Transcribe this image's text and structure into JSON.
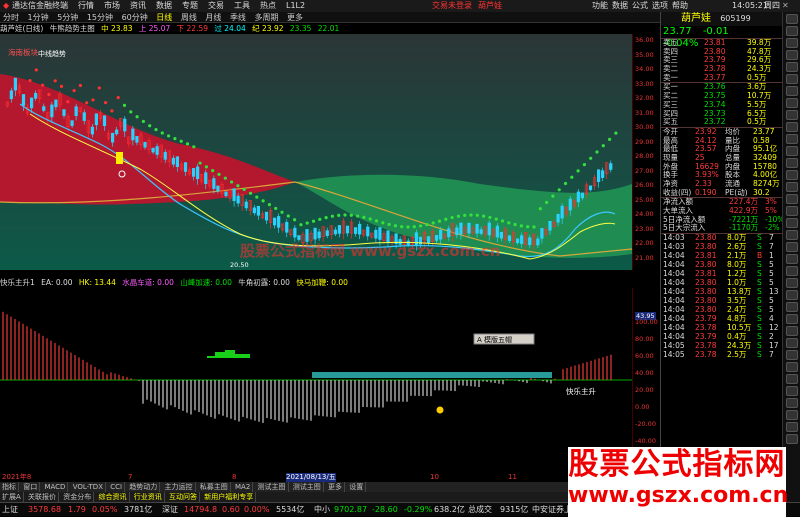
{
  "menubar": {
    "brand": "通达信金融终端",
    "items": [
      "行情",
      "市场",
      "资讯",
      "数据",
      "专题",
      "交易",
      "工具",
      "热点",
      "L1L2"
    ],
    "login": "交易未登录",
    "stock": "葫芦娃",
    "right": [
      "功能",
      "数据",
      "公式",
      "选项",
      "帮助"
    ],
    "time": "14:05:21",
    "weekday": "周四"
  },
  "periods": [
    "分时",
    "1分钟",
    "5分钟",
    "15分钟",
    "60分钟",
    "日线",
    "周线",
    "月线",
    "季线",
    "多周期",
    "更多"
  ],
  "active_period": "日线",
  "main_info": {
    "title": "葫芦娃(日线)",
    "formula": "牛熊趋势主图",
    "v1": "中 23.83",
    "v2": "上 25.07",
    "v3": "下 22.59",
    "v4": "过 24.04",
    "v5": "纪 23.92",
    "v6": "23.35",
    "v7": "22.01"
  },
  "chart_labels": {
    "top_left": "海南板块",
    "pattern": "中线趋势",
    "low_label": "20.50"
  },
  "price_axis": [
    "36.00",
    "35.00",
    "34.00",
    "33.00",
    "32.00",
    "31.00",
    "30.00",
    "29.00",
    "28.00",
    "27.00",
    "26.00",
    "25.00",
    "24.00",
    "23.00",
    "22.00",
    "21.00"
  ],
  "ind_info": {
    "name": "快乐主升1",
    "ea": "EA: 0.00",
    "hk": "HK: 13.44",
    "sub1": "水晶车道: 0.00",
    "sub2": "山峰加速: 0.00",
    "sub3": "牛角初露: 0.00",
    "sub4": "快马加鞭: 0.00"
  },
  "sub_axis": [
    "100.00",
    "80.00",
    "60.00",
    "40.00",
    "20.00",
    "0.00",
    "-20.00",
    "-40.00",
    "-60.00",
    "-80.00"
  ],
  "sub_marker": "43.95",
  "sub_label": "快乐主升",
  "popup": "A 模版五帽",
  "time_axis": [
    "2021年8",
    "7",
    "8",
    "9",
    "2021/08/13/五",
    "10",
    "11"
  ],
  "tabs1": [
    "指标",
    "窗口",
    "MACD",
    "VOL-TDX",
    "CCI",
    "趋势动力",
    "主力运控",
    "私募主图",
    "MA2",
    "测试主图",
    "测试主图",
    "更多",
    "设置"
  ],
  "tabs2": [
    "扩展A",
    "关联报价",
    "资金分布",
    "综合资讯",
    "行业资讯",
    "互动问答",
    "新用户福利专享"
  ],
  "status": {
    "sh_label": "上证",
    "sh_val": "3578.68",
    "sh_chg": "1.79",
    "sh_pct": "0.05%",
    "sh_amt": "3781亿",
    "sz_label": "深证",
    "sz_val": "14794.8",
    "sz_chg": "0.60",
    "sz_pct": "0.00%",
    "sz_amt": "5534亿",
    "zx_label": "中小",
    "zx_val": "9702.87",
    "zx_chg": "-28.60",
    "zx_pct": "-0.29%",
    "zx_amt": "638.2亿",
    "total_label": "总成交",
    "total_amt": "9315亿",
    "broker": "中安证券上海上证 深分"
  },
  "stock": {
    "name": "葫芦娃",
    "code": "605199",
    "price": "23.77",
    "change": "-0.01",
    "pct": "-0.04%"
  },
  "asks": [
    {
      "l": "卖五",
      "p": "23.81",
      "v": "39.8万"
    },
    {
      "l": "卖四",
      "p": "23.80",
      "v": "47.8万"
    },
    {
      "l": "卖三",
      "p": "23.79",
      "v": "29.6万"
    },
    {
      "l": "卖二",
      "p": "23.78",
      "v": "24.3万"
    },
    {
      "l": "卖一",
      "p": "23.77",
      "v": "0.5万"
    }
  ],
  "bids": [
    {
      "l": "买一",
      "p": "23.76",
      "v": "3.6万"
    },
    {
      "l": "买二",
      "p": "23.75",
      "v": "10.7万"
    },
    {
      "l": "买三",
      "p": "23.74",
      "v": "5.5万"
    },
    {
      "l": "买四",
      "p": "23.73",
      "v": "6.5万"
    },
    {
      "l": "买五",
      "p": "23.72",
      "v": "0.5万"
    }
  ],
  "stats": [
    [
      "今开",
      "23.92",
      "均价",
      "23.77"
    ],
    [
      "最高",
      "24.12",
      "量比",
      "0.58"
    ],
    [
      "最低",
      "23.57",
      "内盘",
      "95.1亿"
    ],
    [
      "现量",
      "25",
      "总量",
      "32409"
    ],
    [
      "外盘",
      "16629",
      "内盘",
      "15780"
    ],
    [
      "换手",
      "3.93%",
      "股本",
      "4.00亿"
    ],
    [
      "净资",
      "2.33",
      "流通",
      "8274万"
    ],
    [
      "收益(四)",
      "0.190",
      "PE(动)",
      "30.2"
    ]
  ],
  "flows": [
    [
      "净流入额",
      "227.4万",
      "3%"
    ],
    [
      "大单流入",
      "422.9万",
      "5%"
    ],
    [
      "5日净流入额",
      "-7221万",
      "-10%"
    ],
    [
      "5日大宗流入",
      "-1170万",
      "-2%"
    ]
  ],
  "ticks": [
    [
      "14:03",
      "23.80",
      "8.0万",
      "S",
      "7"
    ],
    [
      "14:03",
      "23.80",
      "2.6万",
      "S",
      "7"
    ],
    [
      "14:04",
      "23.81",
      "2.1万",
      "B",
      "1"
    ],
    [
      "14:04",
      "23.80",
      "8.0万",
      "S",
      "5"
    ],
    [
      "14:04",
      "23.81",
      "1.2万",
      "S",
      "5"
    ],
    [
      "14:04",
      "23.80",
      "1.0万",
      "S",
      "5"
    ],
    [
      "14:04",
      "23.80",
      "13.8万",
      "S",
      "13"
    ],
    [
      "14:04",
      "23.80",
      "3.5万",
      "S",
      "5"
    ],
    [
      "14:04",
      "23.80",
      "2.4万",
      "S",
      "5"
    ],
    [
      "14:04",
      "23.79",
      "4.8万",
      "S",
      "4"
    ],
    [
      "14:04",
      "23.78",
      "10.5万",
      "S",
      "12"
    ],
    [
      "14:04",
      "23.79",
      "0.4万",
      "S",
      "2"
    ],
    [
      "14:05",
      "23.78",
      "24.3万",
      "S",
      "17"
    ],
    [
      "14:05",
      "23.78",
      "2.5万",
      "S",
      "7"
    ]
  ],
  "watermark": {
    "line1": "股票公式指标网",
    "line2": "www.gszx.com.cn"
  },
  "colors": {
    "up": "#ff3b3b",
    "down": "#00e000",
    "accent": "#ffff00",
    "cloud_red": "#b3182e",
    "cloud_green": "#1f8d52",
    "bg_top": "#2a3b39",
    "bg_bottom": "#0d5646"
  }
}
